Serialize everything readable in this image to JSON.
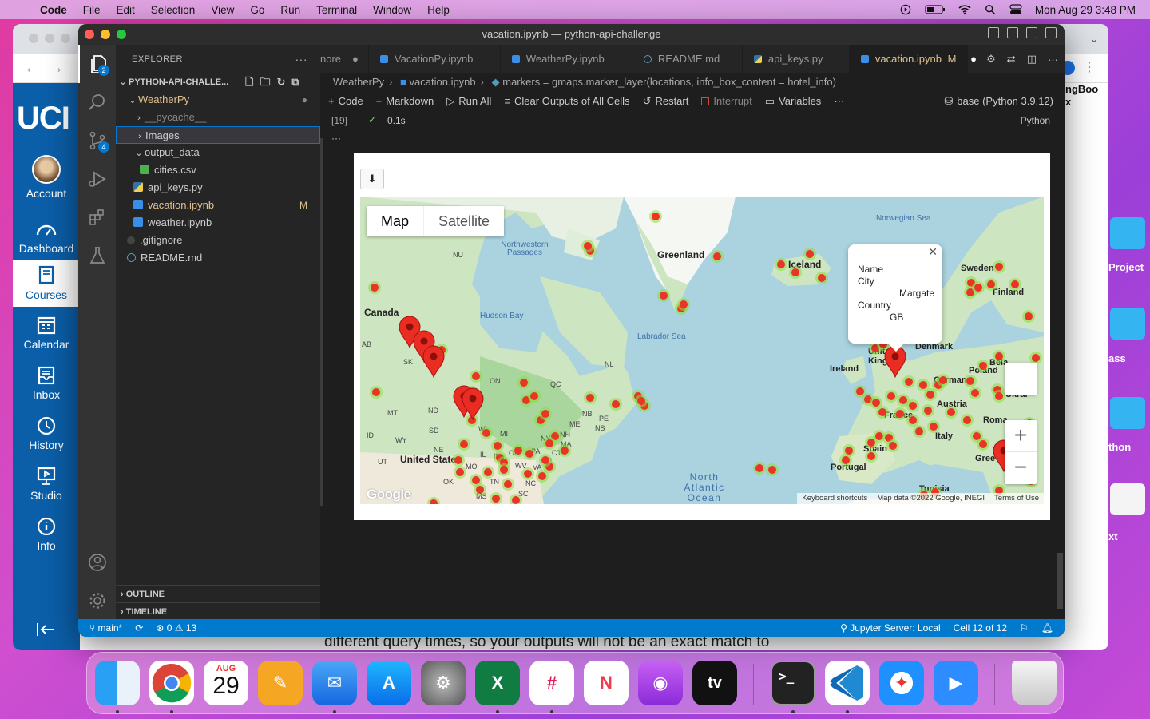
{
  "menubar": {
    "app": "Code",
    "items": [
      "File",
      "Edit",
      "Selection",
      "View",
      "Go",
      "Run",
      "Terminal",
      "Window",
      "Help"
    ],
    "datetime": "Mon Aug 29  3:48 PM"
  },
  "canvas": {
    "logo": "UCI",
    "nav": [
      "Account",
      "Dashboard",
      "Courses",
      "Calendar",
      "Inbox",
      "History",
      "Studio",
      "Info"
    ],
    "right_peek": [
      "ngBoo",
      "x",
      "Project",
      "ass",
      "thon",
      "xt"
    ]
  },
  "window": {
    "title": "vacation.ipynb — python-api-challenge"
  },
  "explorer": {
    "header": "EXPLORER",
    "project": "PYTHON-API-CHALLE...",
    "items": [
      {
        "label": "WeatherPy",
        "kind": "folder-open"
      },
      {
        "label": "__pycache__",
        "kind": "folder"
      },
      {
        "label": "Images",
        "kind": "folder"
      },
      {
        "label": "output_data",
        "kind": "folder-open"
      },
      {
        "label": "cities.csv",
        "kind": "csv"
      },
      {
        "label": "api_keys.py",
        "kind": "py"
      },
      {
        "label": "vacation.ipynb",
        "kind": "nb",
        "status": "M"
      },
      {
        "label": "weather.ipynb",
        "kind": "nb"
      },
      {
        "label": ".gitignore",
        "kind": "git"
      },
      {
        "label": "README.md",
        "kind": "md"
      }
    ],
    "sections": [
      "OUTLINE",
      "TIMELINE"
    ]
  },
  "tabs": [
    {
      "label": "nore",
      "mark": "●"
    },
    {
      "label": "VacationPy.ipynb"
    },
    {
      "label": "WeatherPy.ipynb"
    },
    {
      "label": "README.md"
    },
    {
      "label": "api_keys.py"
    },
    {
      "label": "vacation.ipynb",
      "status": "M",
      "mark": "●"
    }
  ],
  "breadcrumb": [
    "WeatherPy",
    "vacation.ipynb",
    "markers = gmaps.marker_layer(locations, info_box_content = hotel_info)"
  ],
  "toolbar": {
    "code": "Code",
    "markdown": "Markdown",
    "run_all": "Run All",
    "clear": "Clear Outputs of All Cells",
    "restart": "Restart",
    "interrupt": "Interrupt",
    "variables": "Variables",
    "more": "···",
    "kernel": "base (Python 3.9.12)"
  },
  "cell": {
    "exec_count": "[19]",
    "duration": "0.1s",
    "lang": "Python",
    "more": "···"
  },
  "map": {
    "type_buttons": [
      "Map",
      "Satellite"
    ],
    "labels": {
      "greenland": "Greenland",
      "iceland": "Iceland",
      "canada": "Canada",
      "us": "United States",
      "hudson": "Hudson Bay",
      "labrador": "Labrador Sea",
      "norwegian": "Norwegian Sea",
      "nwp": "Northwestern Passages",
      "atlantic": "North Atlantic Ocean",
      "sweden": "Sweden",
      "finland": "Finland",
      "denmark": "Denmark",
      "ireland": "Ireland",
      "uk": "United King",
      "germany": "Germany",
      "poland": "Poland",
      "austria": "Austria",
      "france": "France",
      "italy": "Italy",
      "spain": "Spain",
      "portugal": "Portugal",
      "romania": "Roma",
      "ukraine": "Ukrai",
      "greece": "Gree",
      "tunisia": "Tunisia",
      "belarus": "Bela",
      "nu": "NU",
      "ab": "AB",
      "sk": "SK",
      "on": "ON",
      "qc": "QC",
      "nl": "NL",
      "nb": "NB",
      "pe": "PE",
      "ns": "NS",
      "mt": "MT",
      "nd": "ND",
      "sd": "SD",
      "wy": "WY",
      "id": "ID",
      "ne": "NE",
      "ut": "UT",
      "ok": "OK",
      "mo": "MO",
      "in": "IN",
      "oh": "OH",
      "pa": "PA",
      "wv": "WV",
      "va": "VA",
      "tn": "TN",
      "nc": "NC",
      "sc": "SC",
      "ms": "MS",
      "mi": "MI",
      "wi": "WI",
      "ma": "MA",
      "nh": "NH",
      "ny": "NY",
      "nj": "NJ",
      "il": "IL",
      "ia": "IA",
      "me": "ME",
      "ct": "CT"
    },
    "infobox": {
      "name_label": "Name",
      "city_label": "City",
      "city": "Margate",
      "country_label": "Country",
      "country": "GB"
    },
    "footer": [
      "Keyboard shortcuts",
      "Map data ©2022 Google, INEGI",
      "Terms of Use"
    ],
    "google": "Google"
  },
  "status": {
    "branch": "main*",
    "errors": "0",
    "warnings": "13",
    "jupyter": "Jupyter Server: Local",
    "cell": "Cell 12 of 12"
  },
  "peek": "different query times, so your outputs will not be an exact match to",
  "dock": {
    "cal_month": "AUG",
    "cal_day": "29",
    "tv": "tv"
  }
}
